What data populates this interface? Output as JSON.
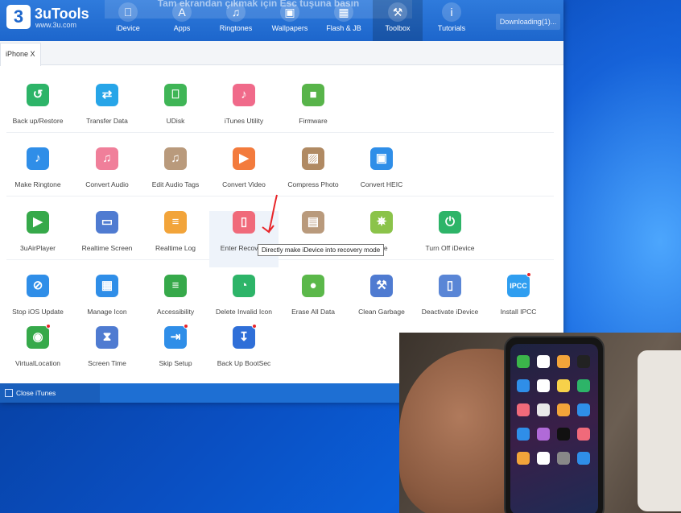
{
  "app": {
    "name": "3uTools",
    "url": "www.3u.com",
    "logo_glyph": "3",
    "overlay_hint": "Tam ekrandan çıkmak için  Esc  tuşuna basın",
    "download_status": "Downloading(1)..."
  },
  "nav": [
    {
      "label": "iDevice",
      "icon": "apple-icon"
    },
    {
      "label": "Apps",
      "icon": "apps-icon"
    },
    {
      "label": "Ringtones",
      "icon": "bell-icon"
    },
    {
      "label": "Wallpapers",
      "icon": "wallpaper-icon"
    },
    {
      "label": "Flash & JB",
      "icon": "box-icon"
    },
    {
      "label": "Toolbox",
      "icon": "toolbox-icon"
    },
    {
      "label": "Tutorials",
      "icon": "info-icon"
    }
  ],
  "device_tab": "iPhone X",
  "tools": [
    {
      "label": "Back up/Restore",
      "icon": "backup-icon",
      "color": "#2db468"
    },
    {
      "label": "Transfer Data",
      "icon": "transfer-icon",
      "color": "#27a5e8"
    },
    {
      "label": "UDisk",
      "icon": "usb-icon",
      "color": "#3fb556"
    },
    {
      "label": "iTunes Utility",
      "icon": "music-icon",
      "color": "#f06a8a"
    },
    {
      "label": "Firmware",
      "icon": "cube-icon",
      "color": "#58b44a"
    },
    {
      "label": "Make Ringtone",
      "icon": "bell-plus-icon",
      "color": "#2f8ee8"
    },
    {
      "label": "Convert Audio",
      "icon": "audio-icon",
      "color": "#f07f9a"
    },
    {
      "label": "Edit Audio Tags",
      "icon": "audio-tag-icon",
      "color": "#b99a7c"
    },
    {
      "label": "Convert Video",
      "icon": "play-icon",
      "color": "#f37b3d"
    },
    {
      "label": "Compress Photo",
      "icon": "photo-icon",
      "color": "#b08a63"
    },
    {
      "label": "Convert HEIC",
      "icon": "image-icon",
      "color": "#2f8ee8"
    },
    {
      "label": "3uAirPlayer",
      "icon": "airplay-icon",
      "color": "#36a94a"
    },
    {
      "label": "Realtime Screen",
      "icon": "monitor-icon",
      "color": "#4f7bd1"
    },
    {
      "label": "Realtime Log",
      "icon": "log-icon",
      "color": "#f2a43a"
    },
    {
      "label": "Enter Recovery",
      "icon": "recovery-icon",
      "color": "#f06a7a"
    },
    {
      "label": "",
      "icon": "terminal-icon",
      "color": "#b99a7c"
    },
    {
      "label": "vice",
      "icon": "sparkle-icon",
      "color": "#8bc34a"
    },
    {
      "label": "Turn Off iDevice",
      "icon": "power-icon",
      "color": "#2db468"
    },
    {
      "label": "Stop iOS Update",
      "icon": "no-update-icon",
      "color": "#2f8ee8"
    },
    {
      "label": "Manage Icon",
      "icon": "grid-icon",
      "color": "#2f8ee8"
    },
    {
      "label": "Accessibility",
      "icon": "toggle-icon",
      "color": "#36a94a"
    },
    {
      "label": "Delete Invalid Icon",
      "icon": "pie-icon",
      "color": "#2db468"
    },
    {
      "label": "Erase All Data",
      "icon": "apple-erase-icon",
      "color": "#5bb84a"
    },
    {
      "label": "Clean Garbage",
      "icon": "broom-icon",
      "color": "#4f7bd1"
    },
    {
      "label": "Deactivate iDevice",
      "icon": "phone-off-icon",
      "color": "#5a86d6"
    },
    {
      "label": "Install IPCC",
      "icon": "ipcc-icon",
      "color": "#2f9ef0",
      "glyph": "IPCC",
      "badge": true
    },
    {
      "label": "VirtualLocation",
      "icon": "location-icon",
      "color": "#36a94a",
      "badge": true
    },
    {
      "label": "Screen Time",
      "icon": "hourglass-icon",
      "color": "#4f7bd1"
    },
    {
      "label": "Skip Setup",
      "icon": "skip-icon",
      "color": "#2f8ee8",
      "badge": true
    },
    {
      "label": "Back Up BootSec",
      "icon": "bootsec-icon",
      "color": "#2f6fd8",
      "badge": true
    }
  ],
  "tooltip": "Directly make iDevice into recovery mode",
  "status": {
    "close_itunes": "Close iTunes"
  }
}
